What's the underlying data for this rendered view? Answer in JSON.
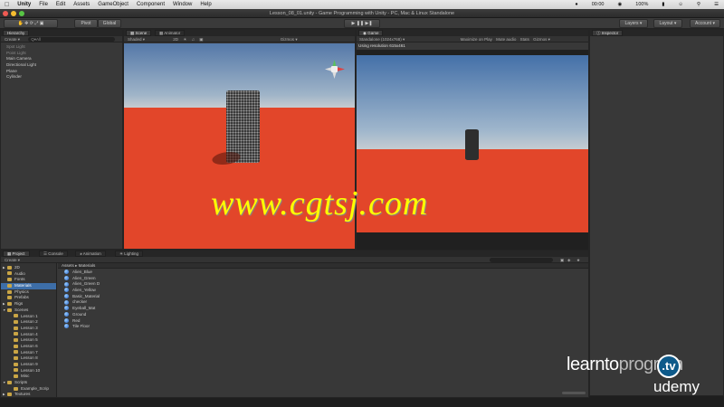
{
  "menubar": {
    "app": "Unity",
    "items": [
      "File",
      "Edit",
      "Assets",
      "GameObject",
      "Component",
      "Window",
      "Help"
    ],
    "tray_time": "00:00",
    "tray_battery": "100%",
    "tray_icons": [
      "wifi-icon",
      "battery-icon",
      "user-icon",
      "search-icon",
      "list-icon"
    ]
  },
  "window": {
    "title": "Lesson_08_01.unity - Game Programming with Unity - PC, Mac & Linux Standalone"
  },
  "toolbar": {
    "pivot": "Pivot",
    "global": "Global",
    "layers": "Layers",
    "layout": "Layout",
    "account": "Account"
  },
  "hierarchy": {
    "tab": "Hierarchy",
    "create": "Create",
    "search": "Q▾All",
    "items": [
      {
        "label": "Spot Light",
        "dim": true
      },
      {
        "label": "Point Light",
        "dim": true
      },
      {
        "label": "Main Camera",
        "dim": false
      },
      {
        "label": "Directional Light",
        "dim": false
      },
      {
        "label": "Plane",
        "dim": false
      },
      {
        "label": "Cylinder",
        "dim": false
      }
    ]
  },
  "scene": {
    "tabs": [
      "Scene",
      "Animator"
    ],
    "shading": "Shaded",
    "gizmos": "Gizmos"
  },
  "game": {
    "tab": "Game",
    "display": "Standalone (1024x768)",
    "maximize": "Maximize on Play",
    "mute": "Mute audio",
    "stats": "Stats",
    "gizmos": "Gizmos",
    "resolution_msg": "Using resolution 615x461"
  },
  "inspector": {
    "tab": "Inspector"
  },
  "bottom_tabs": [
    "Project",
    "Console",
    "Animation",
    "Lighting"
  ],
  "project": {
    "create": "Create",
    "breadcrumb": [
      "Assets",
      "Materials"
    ],
    "folders": [
      {
        "label": "2D",
        "indent": 1,
        "arrow": "▶"
      },
      {
        "label": "Audio",
        "indent": 1,
        "arrow": ""
      },
      {
        "label": "Fonts",
        "indent": 1,
        "arrow": ""
      },
      {
        "label": "Materials",
        "indent": 1,
        "arrow": "",
        "selected": true
      },
      {
        "label": "Physics",
        "indent": 1,
        "arrow": ""
      },
      {
        "label": "Prefabs",
        "indent": 1,
        "arrow": ""
      },
      {
        "label": "Rigs",
        "indent": 1,
        "arrow": "▶"
      },
      {
        "label": "Scenes",
        "indent": 1,
        "arrow": "▼"
      },
      {
        "label": "Lesson 1",
        "indent": 2,
        "arrow": ""
      },
      {
        "label": "Lesson 2",
        "indent": 2,
        "arrow": ""
      },
      {
        "label": "Lesson 3",
        "indent": 2,
        "arrow": ""
      },
      {
        "label": "Lesson 4",
        "indent": 2,
        "arrow": ""
      },
      {
        "label": "Lesson 5",
        "indent": 2,
        "arrow": ""
      },
      {
        "label": "Lesson 6",
        "indent": 2,
        "arrow": ""
      },
      {
        "label": "Lesson 7",
        "indent": 2,
        "arrow": ""
      },
      {
        "label": "Lesson 8",
        "indent": 2,
        "arrow": ""
      },
      {
        "label": "Lesson 9",
        "indent": 2,
        "arrow": ""
      },
      {
        "label": "Lesson 10",
        "indent": 2,
        "arrow": ""
      },
      {
        "label": "Misc",
        "indent": 2,
        "arrow": ""
      },
      {
        "label": "Scripts",
        "indent": 1,
        "arrow": "▼"
      },
      {
        "label": "Example_Scrip",
        "indent": 2,
        "arrow": ""
      },
      {
        "label": "Textures",
        "indent": 1,
        "arrow": "▶"
      }
    ],
    "assets": [
      "Alien_Blue",
      "Alien_Green",
      "Alien_Green D",
      "Alien_Yellow",
      "Basic_Material",
      "checker",
      "Eyeball_Mat",
      "Ground",
      "Red",
      "Tile Floor"
    ]
  },
  "watermark": "www.cgtsj.com",
  "branding": {
    "learn": "learnto",
    "program": "program",
    "tv": ".tv",
    "udemy": "udemy"
  }
}
